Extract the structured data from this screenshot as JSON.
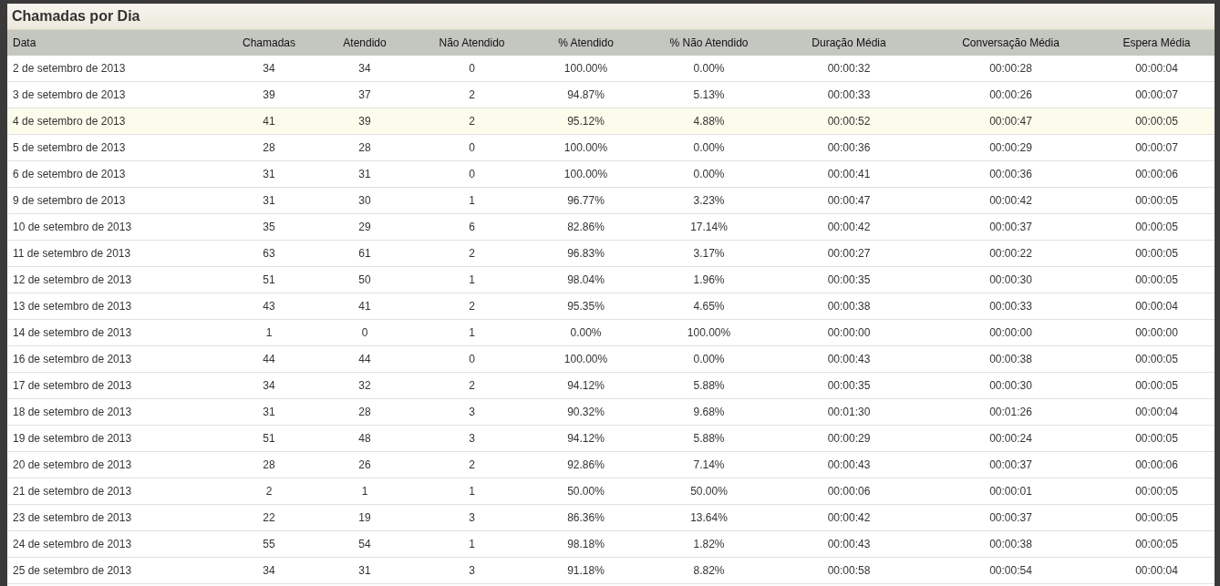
{
  "panel": {
    "title": "Chamadas por Dia"
  },
  "table": {
    "columns": [
      "Data",
      "Chamadas",
      "Atendido",
      "Não Atendido",
      "% Atendido",
      "% Não Atendido",
      "Duração Média",
      "Conversação Média",
      "Espera Média"
    ],
    "rows": [
      {
        "highlighted": false,
        "cells": [
          "2 de setembro de 2013",
          "34",
          "34",
          "0",
          "100.00%",
          "0.00%",
          "00:00:32",
          "00:00:28",
          "00:00:04"
        ]
      },
      {
        "highlighted": false,
        "cells": [
          "3 de setembro de 2013",
          "39",
          "37",
          "2",
          "94.87%",
          "5.13%",
          "00:00:33",
          "00:00:26",
          "00:00:07"
        ]
      },
      {
        "highlighted": true,
        "cells": [
          "4 de setembro de 2013",
          "41",
          "39",
          "2",
          "95.12%",
          "4.88%",
          "00:00:52",
          "00:00:47",
          "00:00:05"
        ]
      },
      {
        "highlighted": false,
        "cells": [
          "5 de setembro de 2013",
          "28",
          "28",
          "0",
          "100.00%",
          "0.00%",
          "00:00:36",
          "00:00:29",
          "00:00:07"
        ]
      },
      {
        "highlighted": false,
        "cells": [
          "6 de setembro de 2013",
          "31",
          "31",
          "0",
          "100.00%",
          "0.00%",
          "00:00:41",
          "00:00:36",
          "00:00:06"
        ]
      },
      {
        "highlighted": false,
        "cells": [
          "9 de setembro de 2013",
          "31",
          "30",
          "1",
          "96.77%",
          "3.23%",
          "00:00:47",
          "00:00:42",
          "00:00:05"
        ]
      },
      {
        "highlighted": false,
        "cells": [
          "10 de setembro de 2013",
          "35",
          "29",
          "6",
          "82.86%",
          "17.14%",
          "00:00:42",
          "00:00:37",
          "00:00:05"
        ]
      },
      {
        "highlighted": false,
        "cells": [
          "11 de setembro de 2013",
          "63",
          "61",
          "2",
          "96.83%",
          "3.17%",
          "00:00:27",
          "00:00:22",
          "00:00:05"
        ]
      },
      {
        "highlighted": false,
        "cells": [
          "12 de setembro de 2013",
          "51",
          "50",
          "1",
          "98.04%",
          "1.96%",
          "00:00:35",
          "00:00:30",
          "00:00:05"
        ]
      },
      {
        "highlighted": false,
        "cells": [
          "13 de setembro de 2013",
          "43",
          "41",
          "2",
          "95.35%",
          "4.65%",
          "00:00:38",
          "00:00:33",
          "00:00:04"
        ]
      },
      {
        "highlighted": false,
        "cells": [
          "14 de setembro de 2013",
          "1",
          "0",
          "1",
          "0.00%",
          "100.00%",
          "00:00:00",
          "00:00:00",
          "00:00:00"
        ]
      },
      {
        "highlighted": false,
        "cells": [
          "16 de setembro de 2013",
          "44",
          "44",
          "0",
          "100.00%",
          "0.00%",
          "00:00:43",
          "00:00:38",
          "00:00:05"
        ]
      },
      {
        "highlighted": false,
        "cells": [
          "17 de setembro de 2013",
          "34",
          "32",
          "2",
          "94.12%",
          "5.88%",
          "00:00:35",
          "00:00:30",
          "00:00:05"
        ]
      },
      {
        "highlighted": false,
        "cells": [
          "18 de setembro de 2013",
          "31",
          "28",
          "3",
          "90.32%",
          "9.68%",
          "00:01:30",
          "00:01:26",
          "00:00:04"
        ]
      },
      {
        "highlighted": false,
        "cells": [
          "19 de setembro de 2013",
          "51",
          "48",
          "3",
          "94.12%",
          "5.88%",
          "00:00:29",
          "00:00:24",
          "00:00:05"
        ]
      },
      {
        "highlighted": false,
        "cells": [
          "20 de setembro de 2013",
          "28",
          "26",
          "2",
          "92.86%",
          "7.14%",
          "00:00:43",
          "00:00:37",
          "00:00:06"
        ]
      },
      {
        "highlighted": false,
        "cells": [
          "21 de setembro de 2013",
          "2",
          "1",
          "1",
          "50.00%",
          "50.00%",
          "00:00:06",
          "00:00:01",
          "00:00:05"
        ]
      },
      {
        "highlighted": false,
        "cells": [
          "23 de setembro de 2013",
          "22",
          "19",
          "3",
          "86.36%",
          "13.64%",
          "00:00:42",
          "00:00:37",
          "00:00:05"
        ]
      },
      {
        "highlighted": false,
        "cells": [
          "24 de setembro de 2013",
          "55",
          "54",
          "1",
          "98.18%",
          "1.82%",
          "00:00:43",
          "00:00:38",
          "00:00:05"
        ]
      },
      {
        "highlighted": false,
        "cells": [
          "25 de setembro de 2013",
          "34",
          "31",
          "3",
          "91.18%",
          "8.82%",
          "00:00:58",
          "00:00:54",
          "00:00:04"
        ]
      }
    ]
  }
}
